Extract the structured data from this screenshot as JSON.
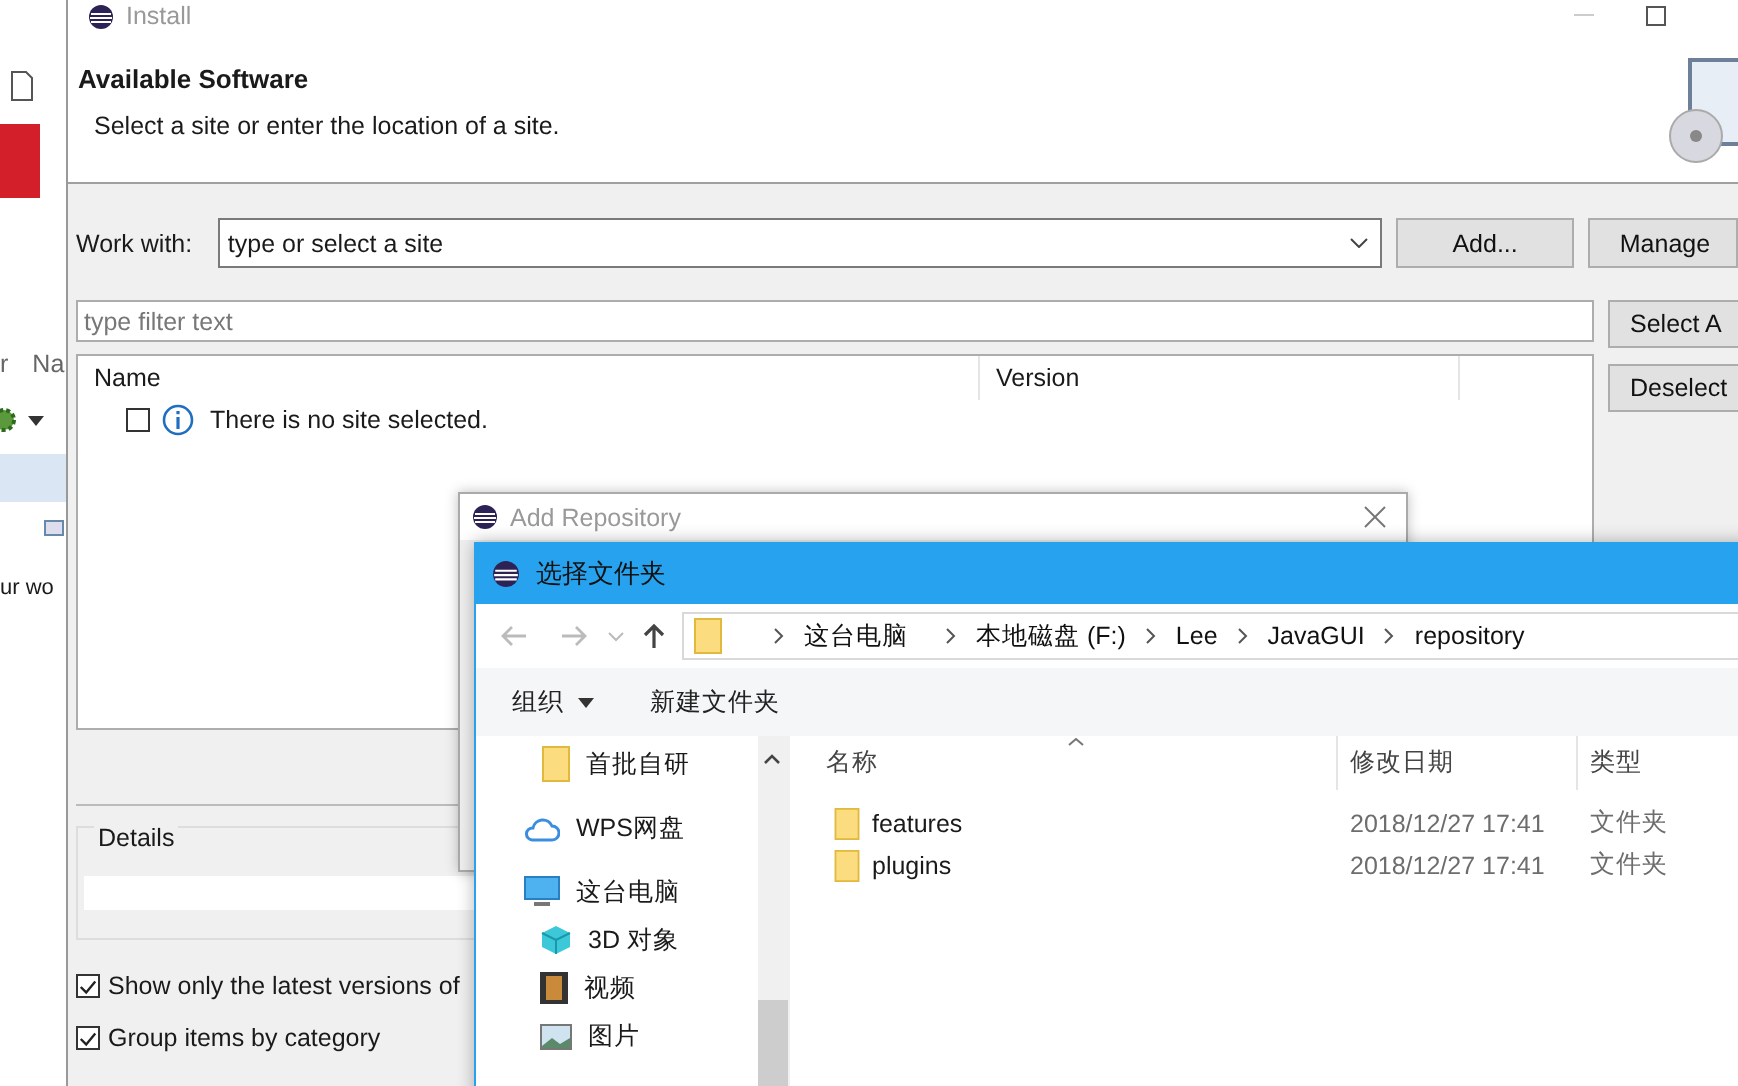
{
  "left_edge": {
    "column_labels": [
      "r",
      "Na"
    ],
    "text": "ur wo"
  },
  "install": {
    "title": "Install",
    "heading": "Available Software",
    "description": "Select a site or enter the location of a site.",
    "work_with": {
      "label": "Work with:",
      "value": "type or select a site"
    },
    "buttons": [
      "Add...",
      "Manage"
    ],
    "filter": {
      "placeholder": "type filter text"
    },
    "side_buttons": [
      "Select A",
      "Deselect"
    ],
    "table": {
      "columns": [
        "Name",
        "Version"
      ],
      "rows": [
        {
          "checked": false,
          "text": "There is no site selected."
        }
      ]
    },
    "details": {
      "label": "Details"
    },
    "options": [
      {
        "label": "Show only the latest versions of",
        "checked": true
      },
      {
        "label": "Group items by category",
        "checked": true
      }
    ]
  },
  "add_repository": {
    "title": "Add Repository"
  },
  "folder_dialog": {
    "title": "选择文件夹",
    "path": [
      "这台电脑",
      "本地磁盘 (F:)",
      "Lee",
      "JavaGUI",
      "repository"
    ],
    "toolbar": [
      {
        "label": "组织",
        "kind": "menu"
      },
      {
        "label": "新建文件夹",
        "kind": "button"
      }
    ],
    "nav": [
      {
        "label": "首批自研",
        "kind": "folder"
      },
      {
        "label": "WPS网盘",
        "kind": "cloud"
      },
      {
        "label": "这台电脑",
        "kind": "pc",
        "children": [
          {
            "label": "3D 对象",
            "kind": "cube"
          },
          {
            "label": "视频",
            "kind": "video"
          },
          {
            "label": "图片",
            "kind": "picture"
          }
        ]
      }
    ],
    "columns": [
      "名称",
      "修改日期",
      "类型"
    ],
    "files": [
      {
        "name": "features",
        "modified": "2018/12/27 17:41",
        "type": "文件夹"
      },
      {
        "name": "plugins",
        "modified": "2018/12/27 17:41",
        "type": "文件夹"
      }
    ]
  }
}
